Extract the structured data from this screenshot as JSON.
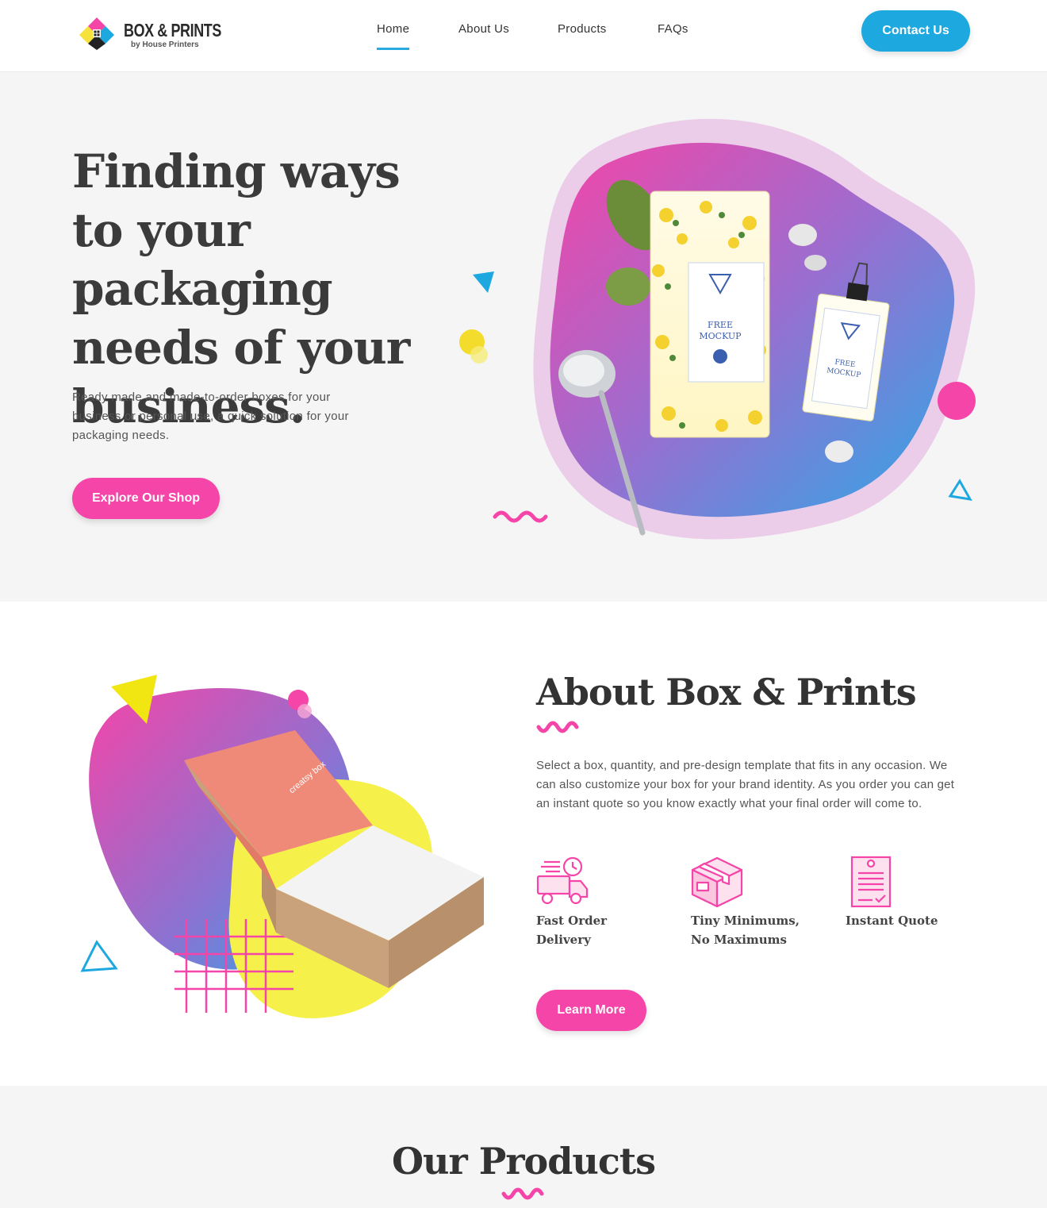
{
  "brand": {
    "title": "BOX & PRINTS",
    "subtitle": "by House Printers"
  },
  "nav": {
    "items": [
      {
        "label": "Home",
        "active": true
      },
      {
        "label": "About Us",
        "active": false
      },
      {
        "label": "Products",
        "active": false
      },
      {
        "label": "FAQs",
        "active": false
      }
    ],
    "cta_label": "Contact Us"
  },
  "hero": {
    "title": "Finding ways to your packaging needs of your business.",
    "text": "Ready made and made-to-order boxes for your business or personal use, a quick solution for your packaging needs.",
    "button_label": "Explore Our Shop",
    "mockup": {
      "pouch_text": [
        "FREE",
        "MOCKUP"
      ],
      "tag_text": [
        "FREE",
        "MOCKUP"
      ]
    }
  },
  "about": {
    "title": "About Box & Prints",
    "text": "Select a box, quantity, and pre-design template that fits in any occasion. We can also customize your box for your brand identity. As you order you can get an instant quote so you know exactly what your final order will come to.",
    "features": [
      {
        "icon": "delivery-truck-icon",
        "label": "Fast Order Delivery"
      },
      {
        "icon": "box-icon",
        "label": "Tiny Minimums, No Maximums"
      },
      {
        "icon": "quote-document-icon",
        "label": "Instant Quote"
      }
    ],
    "button_label": "Learn More",
    "box_brand": "creatsy box"
  },
  "products": {
    "title": "Our Products"
  },
  "colors": {
    "accent_blue": "#1ea8e0",
    "accent_pink": "#f545a8",
    "accent_yellow": "#f5f04a",
    "hero_bg": "#f5f5f5"
  }
}
